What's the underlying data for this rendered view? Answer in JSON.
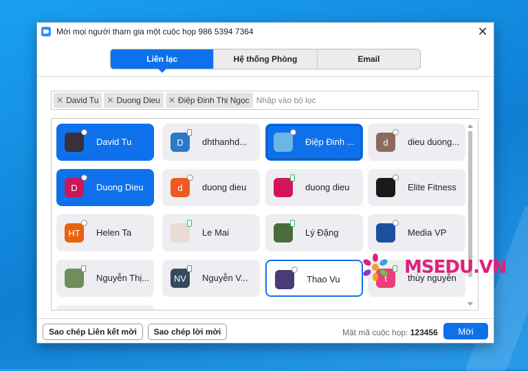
{
  "window": {
    "title": "Mời mọi người tham gia một cuộc họp 986 5394 7364",
    "close_glyph": "✕"
  },
  "tabs": [
    {
      "label": "Liên lạc",
      "active": true
    },
    {
      "label": "Hệ thống Phòng",
      "active": false
    },
    {
      "label": "Email",
      "active": false
    }
  ],
  "filter": {
    "chips": [
      "David Tu",
      "Duong Dieu",
      "Điệp Đinh Thị Ngọc"
    ],
    "chip_remove_glyph": "✕",
    "placeholder": "Nhập vào bộ lọc"
  },
  "contacts": [
    {
      "name": "David Tu",
      "avatar_text": "",
      "avatar_color": "#3a2f3a",
      "status": "online",
      "state": "selected"
    },
    {
      "name": "dhthanhd...",
      "avatar_text": "D",
      "avatar_color": "#2b79c9",
      "status": "phone",
      "state": "normal"
    },
    {
      "name": "Điệp Đinh ...",
      "avatar_text": "",
      "avatar_color": "#6bb6e6",
      "status": "online",
      "state": "selected-focused"
    },
    {
      "name": "dieu duong...",
      "avatar_text": "d",
      "avatar_color": "#8b6a5e",
      "status": "online",
      "state": "normal"
    },
    {
      "name": "Duong Dieu",
      "avatar_text": "D",
      "avatar_color": "#c8185a",
      "status": "online",
      "state": "selected"
    },
    {
      "name": "duong dieu",
      "avatar_text": "d",
      "avatar_color": "#ee5a24",
      "status": "online",
      "state": "normal"
    },
    {
      "name": "duong dieu",
      "avatar_text": "",
      "avatar_color": "#d4145a",
      "status": "phone",
      "state": "normal"
    },
    {
      "name": "Elite Fitness",
      "avatar_text": "",
      "avatar_color": "#1a1a1a",
      "status": "online",
      "state": "normal"
    },
    {
      "name": "Helen Ta",
      "avatar_text": "HT",
      "avatar_color": "#e8620c",
      "status": "online",
      "state": "normal"
    },
    {
      "name": "Le Mai",
      "avatar_text": "",
      "avatar_color": "#e8dcd4",
      "status": "phone",
      "state": "normal"
    },
    {
      "name": "Lý Đặng",
      "avatar_text": "",
      "avatar_color": "#4a6b3a",
      "status": "phone",
      "state": "normal"
    },
    {
      "name": "Media VP",
      "avatar_text": "",
      "avatar_color": "#1e4f9e",
      "status": "online",
      "state": "normal"
    },
    {
      "name": "Nguyễn Thị...",
      "avatar_text": "",
      "avatar_color": "#6e8f5a",
      "status": "phone",
      "state": "normal"
    },
    {
      "name": "Nguyễn V...",
      "avatar_text": "NV",
      "avatar_color": "#34495e",
      "status": "phone",
      "state": "normal"
    },
    {
      "name": "Thao Vu",
      "avatar_text": "",
      "avatar_color": "#4b3a7a",
      "status": "online",
      "state": "outlined"
    },
    {
      "name": "thùy nguyễn",
      "avatar_text": "t",
      "avatar_color": "#ec3d7a",
      "status": "phone",
      "state": "normal"
    }
  ],
  "footer": {
    "copy_link_label": "Sao chép Liên kết mời",
    "copy_invite_label": "Sao chép lời mời",
    "password_label": "Mật mã cuộc họp:",
    "password_value": "123456",
    "invite_label": "Mời"
  },
  "watermark": {
    "text": "MSEDU.VN"
  },
  "colors": {
    "accent": "#0e71eb",
    "desktop": "#1a8fe3",
    "watermark": "#e0207a"
  }
}
